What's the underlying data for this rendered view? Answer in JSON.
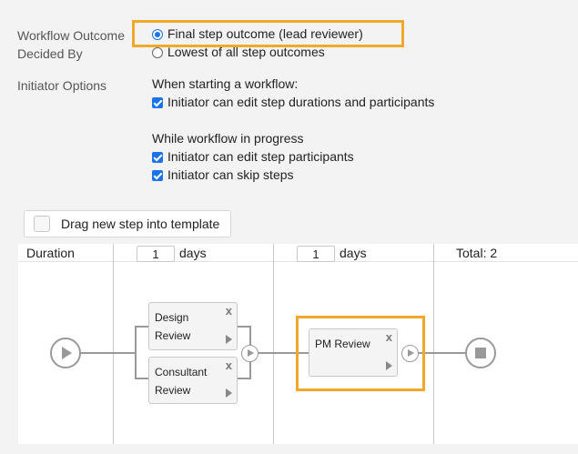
{
  "workflow_outcome": {
    "label_line1": "Workflow Outcome",
    "label_line2": "Decided By",
    "options": [
      {
        "label": "Final step outcome (lead reviewer)",
        "selected": true
      },
      {
        "label": "Lowest of all step outcomes",
        "selected": false
      }
    ]
  },
  "initiator": {
    "label": "Initiator Options",
    "starting_heading": "When starting a workflow:",
    "starting_options": [
      {
        "label": "Initiator can edit step durations and participants",
        "checked": true
      }
    ],
    "progress_heading": "While workflow in progress",
    "progress_options": [
      {
        "label": "Initiator can edit step participants",
        "checked": true
      },
      {
        "label": "Initiator can skip steps",
        "checked": true
      }
    ]
  },
  "template": {
    "drag_label": "Drag new step into template",
    "duration_label": "Duration",
    "stage1_value": "1",
    "stage2_value": "1",
    "days_label": "days",
    "total_label": "Total: 2",
    "steps": [
      {
        "line1": "Design",
        "line2": "Review"
      },
      {
        "line1": "Consultant",
        "line2": "Review"
      },
      {
        "line1": "PM Review",
        "line2": ""
      }
    ],
    "close_glyph": "x"
  },
  "colors": {
    "highlight": "#f0a929",
    "accent": "#1a73e8"
  }
}
